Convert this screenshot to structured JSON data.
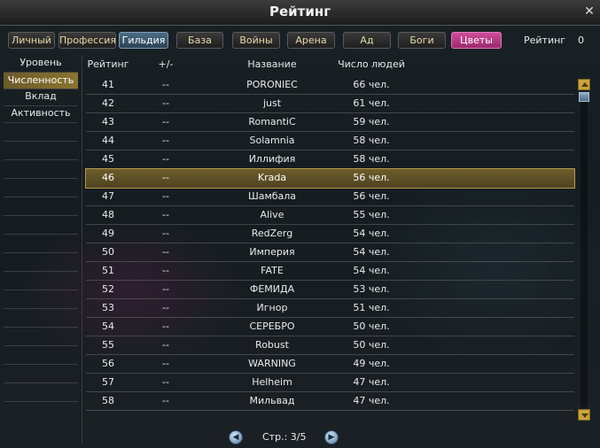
{
  "window": {
    "title": "Рейтинг"
  },
  "tabs": [
    {
      "label": "Личный"
    },
    {
      "label": "Профессия"
    },
    {
      "label": "Гильдия"
    },
    {
      "label": "База"
    },
    {
      "label": "Войны"
    },
    {
      "label": "Арена"
    },
    {
      "label": "Ад"
    },
    {
      "label": "Боги"
    },
    {
      "label": "Цветы"
    }
  ],
  "active_tab": "Гильдия",
  "header_rating": {
    "label": "Рейтинг",
    "value": "0"
  },
  "sidebar": {
    "items": [
      {
        "label": "Уровень"
      },
      {
        "label": "Численность"
      },
      {
        "label": "Вклад"
      },
      {
        "label": "Активность"
      }
    ],
    "selected": "Численность"
  },
  "table": {
    "columns": [
      "Рейтинг",
      "+/-",
      "Название",
      "Число людей"
    ],
    "highlighted_rank": "46",
    "rows": [
      {
        "rank": "41",
        "change": "--",
        "name": "PORONIEC",
        "count": "66 чел."
      },
      {
        "rank": "42",
        "change": "--",
        "name": "just",
        "count": "61 чел."
      },
      {
        "rank": "43",
        "change": "--",
        "name": "RomantiC",
        "count": "59 чел."
      },
      {
        "rank": "44",
        "change": "--",
        "name": "Solamnia",
        "count": "58 чел."
      },
      {
        "rank": "45",
        "change": "--",
        "name": "Иллифия",
        "count": "58 чел."
      },
      {
        "rank": "46",
        "change": "--",
        "name": "Krada",
        "count": "56 чел."
      },
      {
        "rank": "47",
        "change": "--",
        "name": "Шамбала",
        "count": "56 чел."
      },
      {
        "rank": "48",
        "change": "--",
        "name": "Alive",
        "count": "55 чел."
      },
      {
        "rank": "49",
        "change": "--",
        "name": "RedZerg",
        "count": "54 чел."
      },
      {
        "rank": "50",
        "change": "--",
        "name": "Империя",
        "count": "54 чел."
      },
      {
        "rank": "51",
        "change": "--",
        "name": "FATE",
        "count": "54 чел."
      },
      {
        "rank": "52",
        "change": "--",
        "name": "ФЕМИДА",
        "count": "53 чел."
      },
      {
        "rank": "53",
        "change": "--",
        "name": "Игнор",
        "count": "51 чел."
      },
      {
        "rank": "54",
        "change": "--",
        "name": "СЕРЕБРО",
        "count": "50 чел."
      },
      {
        "rank": "55",
        "change": "--",
        "name": "Robust",
        "count": "50 чел."
      },
      {
        "rank": "56",
        "change": "--",
        "name": "WARNING",
        "count": "49 чел."
      },
      {
        "rank": "57",
        "change": "--",
        "name": "Helheim",
        "count": "47 чел."
      },
      {
        "rank": "58",
        "change": "--",
        "name": "Мильвад",
        "count": "47 чел."
      }
    ]
  },
  "pager": {
    "text": "Стр.: 3/5",
    "prev_icon": "arrow-left-icon",
    "next_icon": "arrow-right-icon"
  },
  "colors": {
    "highlight": "#6d5d2c",
    "active_tab": "#4c6c86",
    "flower_tab": "#d04c9a",
    "scroll_button": "#caa53a"
  }
}
